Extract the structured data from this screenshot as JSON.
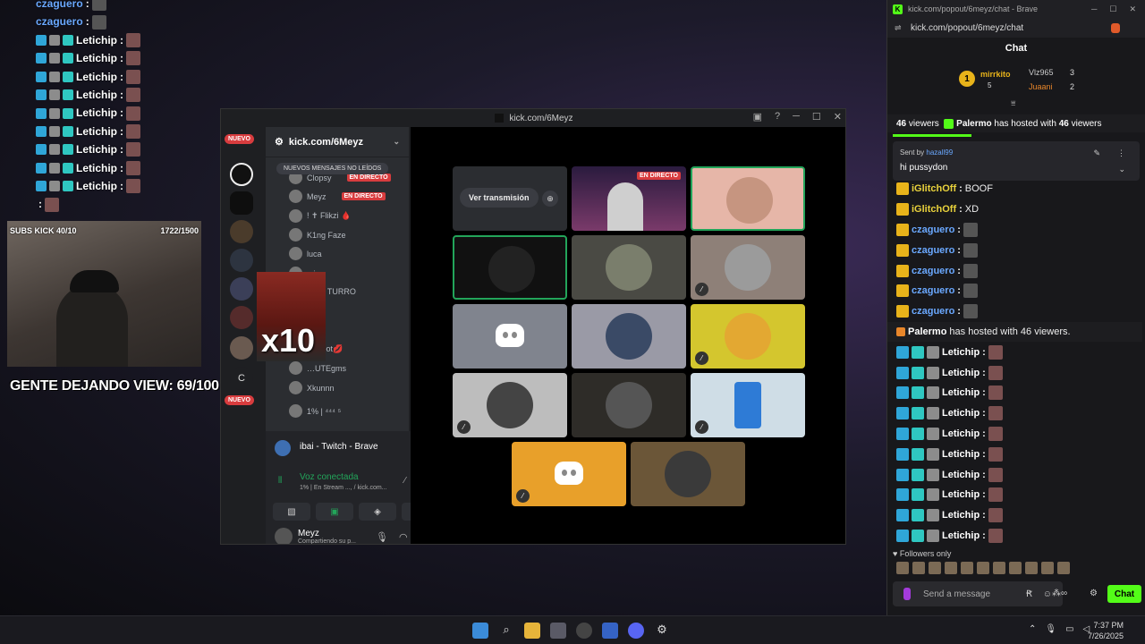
{
  "overlay": {
    "chat": [
      {
        "name": "czaguero",
        "sep": ":",
        "kind": "blue"
      },
      {
        "name": "czaguero",
        "sep": ":",
        "kind": "blue"
      },
      {
        "name": "Letichip",
        "sep": ":",
        "kind": "white"
      },
      {
        "name": "Letichip",
        "sep": ":",
        "kind": "white"
      },
      {
        "name": "Letichip",
        "sep": ":",
        "kind": "white"
      },
      {
        "name": "Letichip",
        "sep": ":",
        "kind": "white"
      },
      {
        "name": "Letichip",
        "sep": ":",
        "kind": "white"
      },
      {
        "name": "Letichip",
        "sep": ":",
        "kind": "white"
      },
      {
        "name": "Letichip",
        "sep": ":",
        "kind": "white"
      },
      {
        "name": "Letichip",
        "sep": ":",
        "kind": "white"
      },
      {
        "name": "Letichip",
        "sep": ":",
        "kind": "white"
      },
      {
        "name": "",
        "sep": ":",
        "kind": "white"
      }
    ],
    "cam_left_label": "SUBS KICK 40/10",
    "cam_right_label": "1722/1500",
    "gente": "GENTE DEJANDO VIEW: 69/100",
    "x10": "x10"
  },
  "discord": {
    "title": "kick.com/6Meyz",
    "nuevo_top": "NUEVO",
    "nuevo_bottom": "NUEVO",
    "server_c": "C",
    "channel_header": "kick.com/6Meyz",
    "new_messages": "NUEVOS MENSAJES NO LEÍDOS",
    "members": [
      {
        "name": "Clopsy",
        "badge": "EN DIRECTO"
      },
      {
        "name": "Meyz",
        "badge": "EN DIRECTO"
      },
      {
        "name": "! ✝ Flikzi 🩸",
        "badge": ""
      },
      {
        "name": "K1ng Faze",
        "badge": ""
      },
      {
        "name": "luca",
        "badge": ""
      },
      {
        "name": "mir",
        "badge": ""
      },
      {
        "name": "…lito TURRO",
        "badge": ""
      },
      {
        "name": "…ta",
        "badge": ""
      },
      {
        "name": "…a bot💋",
        "badge": ""
      },
      {
        "name": "…UTEgms",
        "badge": ""
      },
      {
        "name": "Xkunnn",
        "badge": ""
      },
      {
        "name": "1% | ⁴⁴⁴ ⁵",
        "badge": ""
      }
    ],
    "activity": "ibai - Twitch - Brave",
    "voice_status": "Voz conectada",
    "voice_sub": "1% | En Stream ..., / kick.com...",
    "user_name": "Meyz",
    "user_sub": "Compartiendo su p...",
    "watch_button": "Ver transmisión",
    "live_label": "EN DIRECTO"
  },
  "browser": {
    "tab_title": "kick.com/popout/6meyz/chat - Brave",
    "url": "kick.com/popout/6meyz/chat",
    "header": "Chat",
    "leaderboard": {
      "rank": "1",
      "first_name": "mirrkito",
      "first_count": "5",
      "second_name": "Vlz965",
      "second_count": "3",
      "third_name": "Juaani",
      "third_count": "2"
    },
    "host_banner_count": "46",
    "host_banner_text": "viewers",
    "host_banner_name": "Palermo",
    "host_banner_rest": "has hosted with",
    "host_banner_count2": "46",
    "host_banner_tail": "viewers",
    "pinned_sent_by": "Sent by",
    "pinned_user": "hazall99",
    "pinned_msg": "hi pussydon",
    "messages": [
      {
        "name": "iGlitchOff",
        "text": "BOOF",
        "kind": "yellow"
      },
      {
        "name": "iGlitchOff",
        "text": "XD",
        "kind": "yellow"
      },
      {
        "name": "czaguero",
        "text": "",
        "kind": "blue"
      },
      {
        "name": "czaguero",
        "text": "",
        "kind": "blue"
      },
      {
        "name": "czaguero",
        "text": "",
        "kind": "blue"
      },
      {
        "name": "czaguero",
        "text": "",
        "kind": "blue"
      },
      {
        "name": "czaguero",
        "text": "",
        "kind": "blue"
      },
      {
        "name": "Palermo",
        "text": "has hosted with 46 viewers.",
        "kind": "host"
      },
      {
        "name": "Letichip",
        "text": "",
        "kind": "white"
      },
      {
        "name": "Letichip",
        "text": "",
        "kind": "white"
      },
      {
        "name": "Letichip",
        "text": "",
        "kind": "white"
      },
      {
        "name": "Letichip",
        "text": "",
        "kind": "white"
      },
      {
        "name": "Letichip",
        "text": "",
        "kind": "white"
      },
      {
        "name": "Letichip",
        "text": "",
        "kind": "white"
      },
      {
        "name": "Letichip",
        "text": "",
        "kind": "white"
      },
      {
        "name": "Letichip",
        "text": "",
        "kind": "white"
      },
      {
        "name": "Letichip",
        "text": "",
        "kind": "white"
      },
      {
        "name": "Letichip",
        "text": "",
        "kind": "white"
      }
    ],
    "followers_only": "Followers only",
    "send_placeholder": "Send a message",
    "chat_button": "Chat"
  },
  "taskbar": {
    "time": "7:37 PM",
    "date": "7/26/2025"
  },
  "colors": {
    "kick_green": "#53fc18",
    "discord_red": "#d83c3e",
    "discord_green": "#23a55a"
  }
}
